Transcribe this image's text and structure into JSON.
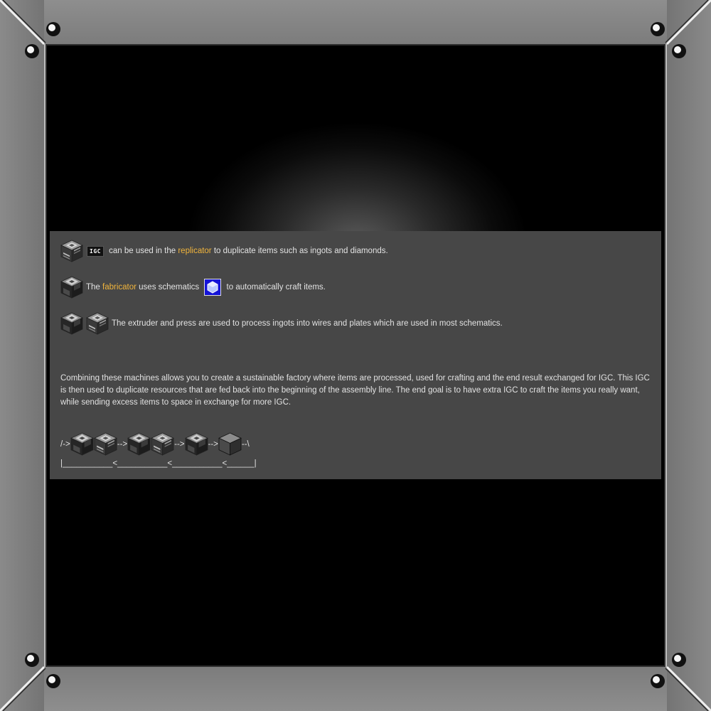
{
  "icons": {
    "replicator": "replicator-machine-icon",
    "fabricator": "fabricator-machine-icon",
    "extruder": "extruder-machine-icon",
    "press": "press-machine-icon",
    "schematic": "schematic-icon",
    "igc": "igc-currency-icon",
    "space_elevator": "space-elevator-block-icon"
  },
  "colors": {
    "highlight": "#f0b43c",
    "panel_background": "#474747",
    "schematic_blue": "#1414d8"
  },
  "row1": {
    "igc_badge": "IGC",
    "text_before": " can be used in the ",
    "link": "replicator",
    "text_after": " to duplicate items such as ingots and diamonds."
  },
  "row2": {
    "text_before": "The ",
    "link": "fabricator",
    "text_middle": " uses schematics ",
    "text_after": " to automatically craft items."
  },
  "row3": {
    "text": "The extruder and press are used to process ingots into wires and plates which are used in most schematics."
  },
  "paragraph": "Combining these machines allows you to create a sustainable factory where items are processed, used for crafting and the end result exchanged for IGC. This IGC is then used to duplicate resources that are fed back into the beginning of the assembly line. The end goal is to have extra IGC to craft the items you really want, while sending excess items to space in exchange for more IGC.",
  "chain": {
    "start": "/->",
    "arrow1": "-->",
    "arrow2": "-->",
    "arrow3": "-->",
    "end": "--\\",
    "loop_line": "|___________<___________<___________<______|"
  }
}
